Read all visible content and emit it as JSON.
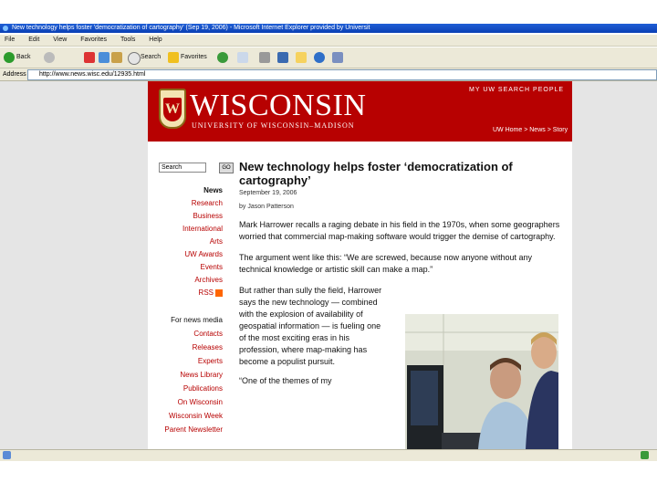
{
  "window": {
    "title": "New technology helps foster 'democratization of cartography' (Sep 19, 2006) - Microsoft Internet Explorer provided by Universit"
  },
  "menu": [
    "File",
    "Edit",
    "View",
    "Favorites",
    "Tools",
    "Help"
  ],
  "toolbar": {
    "back_label": "Back",
    "search_label": "Search",
    "favorites_label": "Favorites"
  },
  "address": {
    "label": "Address",
    "url": "http://www.news.wisc.edu/12935.html"
  },
  "banner": {
    "wordmark": "WISCONSIN",
    "subtitle": "UNIVERSITY OF WISCONSIN–MADISON",
    "top_links": "MY UW   SEARCH   PEOPLE",
    "sub_links": "UW Home > News > Story"
  },
  "search": {
    "placeholder": "Search",
    "button": "GO"
  },
  "nav": [
    "News",
    "Research",
    "Business",
    "International",
    "Arts",
    "UW Awards",
    "Events",
    "Archives",
    "RSS"
  ],
  "nav2": [
    "For news media",
    "Contacts",
    "Releases",
    "Experts",
    "News Library",
    "Publications",
    "On Wisconsin",
    "Wisconsin Week",
    "Parent Newsletter"
  ],
  "article": {
    "headline": "New technology helps foster ‘democratization of cartography’",
    "date": "September 19, 2006",
    "byline": "by Jason Patterson",
    "p1": "Mark Harrower recalls a raging debate in his field in the 1970s, when some geographers worried that commercial map-making software would trigger the demise of cartography.",
    "p2": "The argument went like this: “We are screwed, because now anyone without any technical knowledge or artistic skill can make a map.”",
    "p3": "But rather than sully the field, Harrower says the new technology — combined with the explosion of availability of geospatial information — is fueling one of the most exciting eras in his profession, where map-making has become a populist pursuit.",
    "p4": "“One of the themes of my"
  },
  "colors": {
    "uw_red": "#b70101",
    "xp_blue": "#0a3fb4"
  }
}
